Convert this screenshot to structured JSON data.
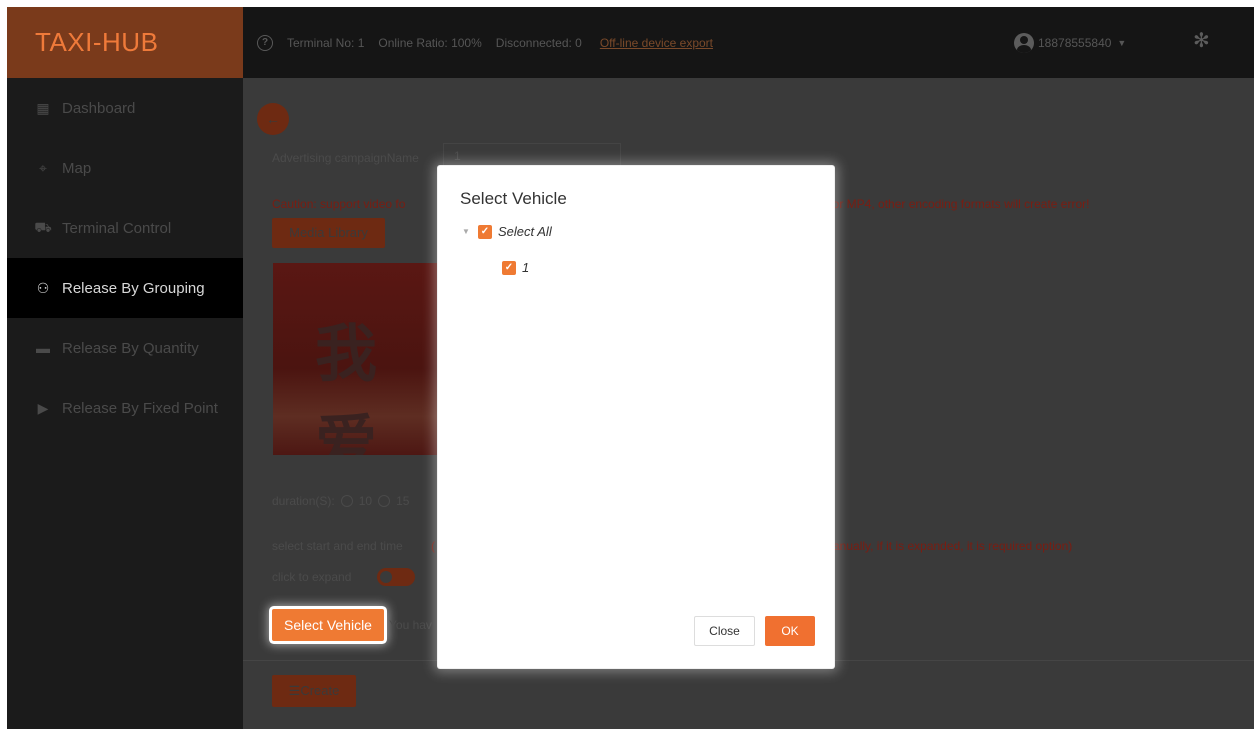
{
  "header": {
    "logo": "TAXI-HUB",
    "terminal_no": "Terminal No: 1",
    "online_ratio": "Online Ratio: 100%",
    "disconnected": "Disconnected: 0",
    "export_link": "Off-line device export",
    "user": "18878555840",
    "icons": [
      "help-icon",
      "user-icon",
      "gear-icon"
    ]
  },
  "sidebar": {
    "items": [
      {
        "label": "Dashboard",
        "icon": "dashboard-icon",
        "active": false
      },
      {
        "label": "Map",
        "icon": "map-icon",
        "active": false
      },
      {
        "label": "Terminal Control",
        "icon": "car-icon",
        "active": false
      },
      {
        "label": "Release By Grouping",
        "icon": "group-icon",
        "active": true
      },
      {
        "label": "Release By Quantity",
        "icon": "list-icon",
        "active": false
      },
      {
        "label": "Release By Fixed Point",
        "icon": "play-icon",
        "active": false
      }
    ]
  },
  "form": {
    "campaign_label": "Advertising campaignName",
    "campaign_value": "1",
    "caution_left": "Caution:  support video fo",
    "caution_right": "ing for MP4, other encoding formats will create error!",
    "media_library": "Media Library",
    "preview_text": "我爱",
    "duration_label": "duration(S):",
    "duration_options": [
      "10",
      "15"
    ],
    "time_label": "select start and end time",
    "time_note_left": "(",
    "time_note_right": "anually, if it is expanded, it is required option)",
    "expand_label": "click to expand",
    "select_vehicle": "Select Vehicle",
    "vehicle_hint": "You hav",
    "create": "Create"
  },
  "modal": {
    "title": "Select Vehicle",
    "tree": [
      {
        "label": "Select All",
        "checked": true,
        "level": 0
      },
      {
        "label": "1",
        "checked": true,
        "level": 1
      }
    ],
    "close": "Close",
    "ok": "OK"
  },
  "colors": {
    "accent": "#ef7a33",
    "logo_bg": "#7a3a1b",
    "caution": "#7a1d12"
  }
}
